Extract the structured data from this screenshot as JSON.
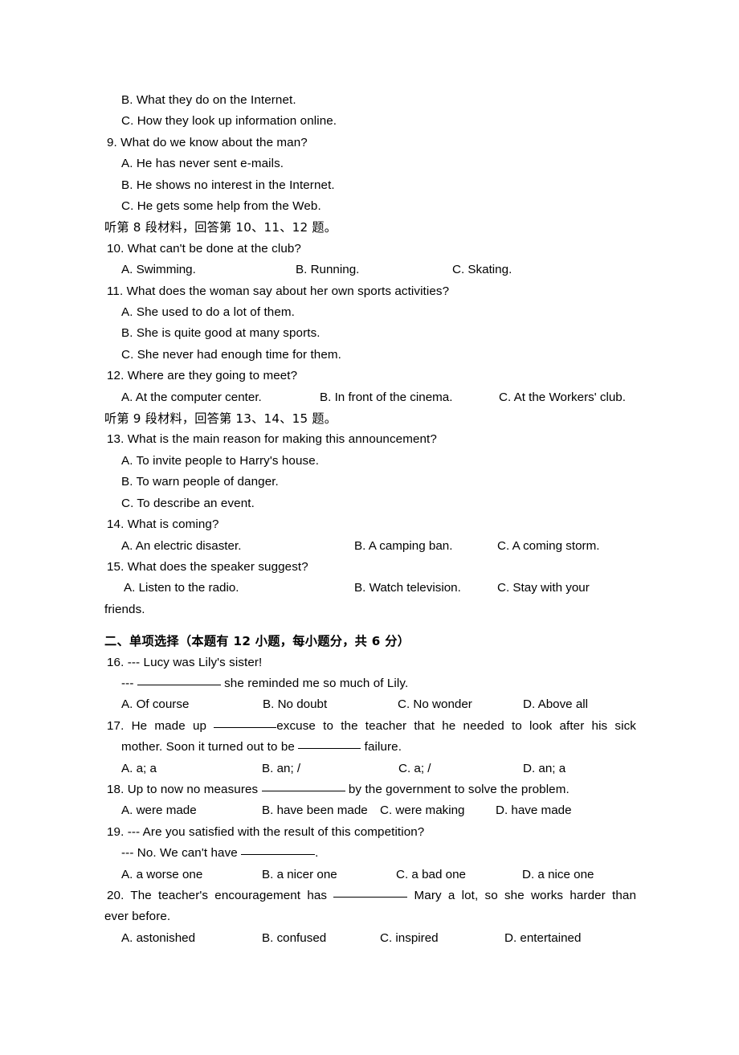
{
  "document": {
    "type": "english-exam-paper",
    "language": "en-CN"
  },
  "listening_section": {
    "carryover_options": [
      "B. What they do on the Internet.",
      "C. How they look up information online."
    ],
    "questions": [
      {
        "number": "9",
        "stem": "9. What do we know about the man?",
        "layout": "stacked",
        "options": [
          "A. He has never sent e-mails.",
          "B. He shows no interest in the Internet.",
          "C. He gets some help from the Web."
        ]
      }
    ],
    "instruction_8": "听第 8 段材料，回答第 10、11、12 题。",
    "questions_8": [
      {
        "number": "10",
        "stem": "10. What can't be done at the club?",
        "layout": "row",
        "options": [
          "A. Swimming.",
          "B. Running.",
          "C. Skating."
        ]
      },
      {
        "number": "11",
        "stem": "11. What does the woman say about her own sports activities?",
        "layout": "stacked",
        "options": [
          "A. She used to do a lot of them.",
          "B. She is quite good at many sports.",
          "C. She never had enough time for them."
        ]
      },
      {
        "number": "12",
        "stem": "12. Where are they going to meet?",
        "layout": "row",
        "options": [
          "A. At the computer center.",
          "B. In front of the cinema.",
          "C. At the Workers' club."
        ]
      }
    ],
    "instruction_9": "听第 9 段材料，回答第 13、14、15 题。",
    "questions_9": [
      {
        "number": "13",
        "stem": "13. What is the main reason for making this announcement?",
        "layout": "stacked",
        "options": [
          "A. To invite people to Harry's house.",
          "B. To warn people of danger.",
          "C. To describe an event."
        ]
      },
      {
        "number": "14",
        "stem": "14. What is coming?",
        "layout": "row",
        "options": [
          "A. An electric disaster.",
          "B. A camping ban.",
          "C. A coming storm."
        ]
      },
      {
        "number": "15",
        "stem": "15. What does the speaker suggest?",
        "layout": "row-wrapped",
        "options": [
          "A. Listen to the radio.",
          "B. Watch television.",
          "C. Stay with your"
        ],
        "wrap_text": "friends."
      }
    ]
  },
  "choice_section": {
    "heading": "二、单项选择（本题有 12 小题，每小题分，共 6 分）",
    "questions": [
      {
        "number": "16",
        "stem": "16. --- Lucy was Lily's sister!",
        "reply_before": "--- ",
        "reply_after": " she reminded me so much of Lily.",
        "options": [
          "A. Of course",
          "B. No doubt",
          "C. No wonder",
          "D. Above all"
        ]
      },
      {
        "number": "17",
        "stem_part1": "17. He made up",
        "stem_part2": "excuse to the teacher that he needed to look after his sick",
        "stem_line2_before": "mother. Soon it turned out to be",
        "stem_line2_after": "failure.",
        "options": [
          "A. a; a",
          "B. an; /",
          "C. a; /",
          "D. an; a"
        ]
      },
      {
        "number": "18",
        "stem_before": "18. Up to now no measures",
        "stem_after": "by the government to solve the problem.",
        "options": [
          "A. were made",
          "B. have been made",
          "C. were making",
          "D. have made"
        ]
      },
      {
        "number": "19",
        "stem": "19. --- Are you satisfied with the result of this competition?",
        "reply_before": "--- No. We can't have",
        "reply_after": ".",
        "options": [
          "A. a worse one",
          "B. a nicer one",
          "C. a bad one",
          "D. a nice one"
        ]
      },
      {
        "number": "20",
        "stem_before": "20. The teacher's encouragement has",
        "stem_after": "Mary a lot, so she works harder than",
        "wrap_text": "ever before.",
        "options": [
          "A. astonished",
          "B. confused",
          "C. inspired",
          "D. entertained"
        ]
      }
    ]
  },
  "columns": {
    "three_col": [
      "0px",
      "217px",
      "412px"
    ],
    "three_col_wide": [
      "0px",
      "290px",
      "490px"
    ],
    "three_col_q12": [
      "0px",
      "247px",
      "470px"
    ],
    "three_col_q15": [
      "3px",
      "290px",
      "468px"
    ],
    "four_col": [
      "0px",
      "176px",
      "344px",
      "500px"
    ],
    "four_col_q17": [
      "0px",
      "175px",
      "345px",
      "500px"
    ],
    "four_col_q18": [
      "0px",
      "175px",
      "322px",
      "466px"
    ]
  },
  "colors": {
    "page_background": "#ffffff",
    "text": "#000000"
  }
}
